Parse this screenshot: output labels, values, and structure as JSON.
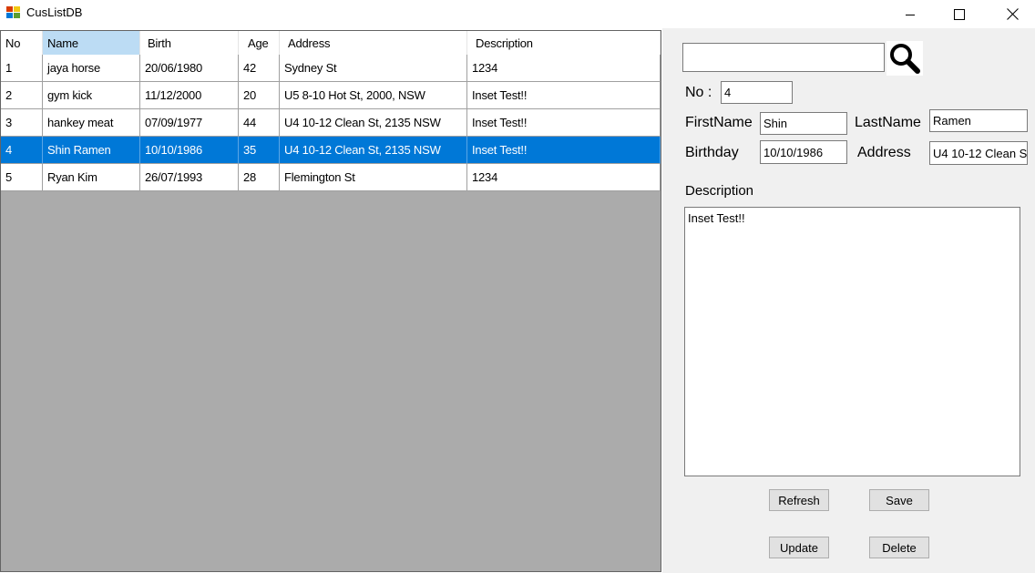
{
  "window": {
    "title": "CusListDB",
    "icon": "app-window-icon",
    "controls": [
      "minimize-icon",
      "maximize-icon",
      "close-icon"
    ]
  },
  "grid": {
    "columns": [
      "No",
      "Name",
      "Birth",
      "Age",
      "Address",
      "Description"
    ],
    "rows": [
      [
        "1",
        "jaya horse",
        "20/06/1980",
        "42",
        "Sydney St",
        "1234"
      ],
      [
        "2",
        "gym kick",
        "11/12/2000",
        "20",
        "U5 8-10 Hot St, 2000, NSW",
        "Inset Test!!"
      ],
      [
        "3",
        "hankey meat",
        "07/09/1977",
        "44",
        "U4 10-12 Clean St, 2135 NSW",
        "Inset Test!!"
      ],
      [
        "4",
        "Shin Ramen",
        "10/10/1986",
        "35",
        "U4 10-12 Clean St, 2135 NSW",
        "Inset Test!!"
      ],
      [
        "5",
        "Ryan Kim",
        "26/07/1993",
        "28",
        "Flemington St",
        "1234"
      ]
    ],
    "selected_row": 4,
    "selection_color": "#0078d7",
    "header_highlight_color": "#bcdcf4"
  },
  "form": {
    "search": {
      "value": "",
      "icon": "search-icon"
    },
    "no": {
      "label": "No :",
      "value": "4"
    },
    "first_name": {
      "label": "FirstName",
      "value": "Shin"
    },
    "last_name": {
      "label": "LastName",
      "value": "Ramen"
    },
    "birthday": {
      "label": "Birthday",
      "value": "10/10/1986"
    },
    "address": {
      "label": "Address",
      "value": "U4 10-12 Clean S"
    },
    "description": {
      "label": "Description",
      "value": "Inset Test!!"
    }
  },
  "buttons": {
    "refresh": "Refresh",
    "save": "Save",
    "update": "Update",
    "delete": "Delete"
  }
}
